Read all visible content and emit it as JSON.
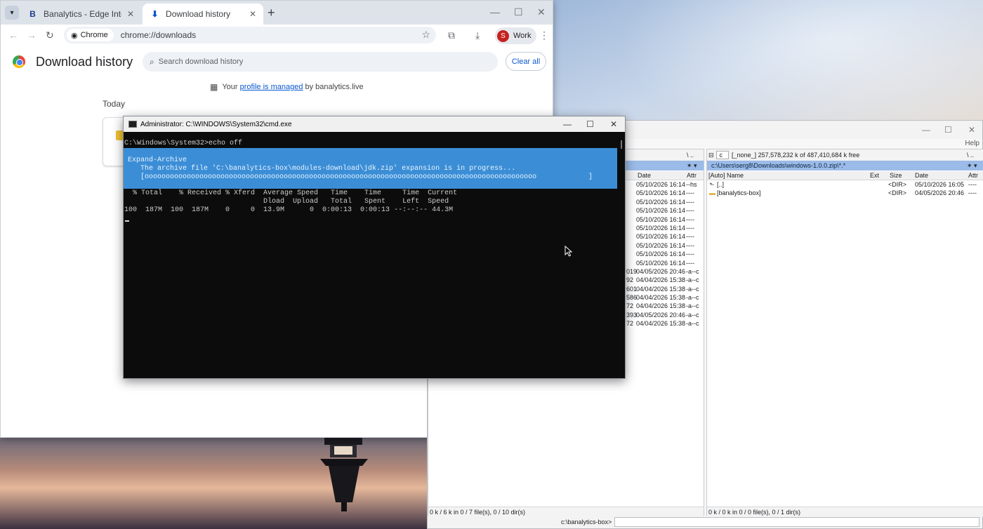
{
  "chrome": {
    "tabs": [
      {
        "label": "Banalytics - Edge Intelligence fo",
        "favicon": "B",
        "active": false
      },
      {
        "label": "Download history",
        "favicon": "⬇",
        "active": true
      }
    ],
    "chip_label": "Chrome",
    "url": "chrome://downloads",
    "profile_initial": "S",
    "profile_label": "Work",
    "page_title": "Download history",
    "search_placeholder": "Search download history",
    "clear_all": "Clear all",
    "managed_prefix": "Your",
    "managed_link": "profile is managed",
    "managed_suffix": "by banalytics.live",
    "today": "Today"
  },
  "cmd": {
    "title": "Administrator: C:\\WINDOWS\\System32\\cmd.exe",
    "prompt_line": "C:\\Windows\\System32>echo off",
    "progress_title": "Expand-Archive",
    "progress_message": "   The archive file 'C:\\banalytics-box\\modules-download\\jdk.zip' expansion is in progress...",
    "progress_bar": "   [ooooooooooooooooooooooooooooooooooooooooooooooooooooooooooooooooooooooooooooooooooooooooooooo",
    "progress_bar_end": "]",
    "curl_header1": "  % Total    % Received % Xferd  Average Speed   Time    Time     Time  Current",
    "curl_header2": "                                 Dload  Upload   Total   Spent    Left  Speed",
    "curl_stats": "100  187M  100  187M    0     0  13.9M      0  0:00:13  0:00:13 --:--:-- 44.3M"
  },
  "fm": {
    "menu_help": "Help",
    "left": {
      "path_nav": "\\  ..",
      "cols": {
        "date": "Date",
        "attr": "Attr"
      },
      "rows": [
        {
          "size": "",
          "date": "05/10/2026 16:14",
          "attr": "--hs"
        },
        {
          "size": "",
          "date": "05/10/2026 16:14",
          "attr": "----"
        },
        {
          "size": "",
          "date": "05/10/2026 16:14",
          "attr": "----"
        },
        {
          "size": "",
          "date": "05/10/2026 16:14",
          "attr": "----"
        },
        {
          "size": "",
          "date": "05/10/2026 16:14",
          "attr": "----"
        },
        {
          "size": "",
          "date": "05/10/2026 16:14",
          "attr": "----"
        },
        {
          "size": "",
          "date": "05/10/2026 16:14",
          "attr": "----"
        },
        {
          "size": "",
          "date": "05/10/2026 16:14",
          "attr": "----"
        },
        {
          "size": "",
          "date": "05/10/2026 16:14",
          "attr": "----"
        },
        {
          "size": "",
          "date": "05/10/2026 16:14",
          "attr": "----"
        },
        {
          "size": "019",
          "date": "04/05/2026 20:46",
          "attr": "-a--c"
        },
        {
          "size": "92",
          "date": "04/04/2026 15:38",
          "attr": "-a--c"
        },
        {
          "size": "601",
          "date": "04/04/2026 15:38",
          "attr": "-a--c"
        },
        {
          "size": "586",
          "date": "04/04/2026 15:38",
          "attr": "-a--c"
        },
        {
          "size": "72",
          "date": "04/04/2026 15:38",
          "attr": "-a--c"
        },
        {
          "size": "393",
          "date": "04/05/2026 20:46",
          "attr": "-a--c"
        },
        {
          "size": "72",
          "date": "04/04/2026 15:38",
          "attr": "-a--c"
        }
      ],
      "status": "0 k / 6 k in 0 / 7 file(s), 0 / 10 dir(s)"
    },
    "right": {
      "drive": "c",
      "drive_info": "[_none_]  257,578,232 k of 487,410,684 k free",
      "path_nav": "\\  ..",
      "path": "c:\\Users\\serg8\\Downloads\\windows-1.0.0.zip\\*.*",
      "cols": {
        "name": "[Auto] Name",
        "ext": "Ext",
        "size": "Size",
        "date": "Date",
        "attr": "Attr"
      },
      "rows": [
        {
          "name": "[..]",
          "size": "<DIR>",
          "date": "05/10/2026 16:05",
          "attr": "----"
        },
        {
          "name": "[banalytics-box]",
          "size": "<DIR>",
          "date": "04/05/2026 20:46",
          "attr": "----"
        }
      ],
      "status": "0 k / 0 k in 0 / 0 file(s), 0 / 1 dir(s)"
    },
    "cmdline_label": "c:\\banalytics-box>"
  }
}
